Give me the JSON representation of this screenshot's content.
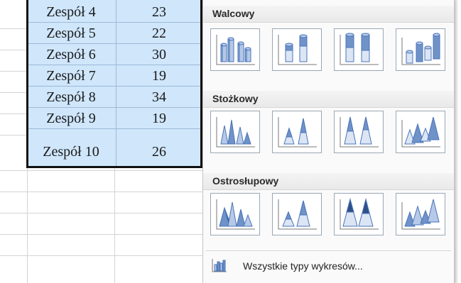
{
  "sheet": {
    "rows": [
      {
        "name": "Zespół 4",
        "value": "23"
      },
      {
        "name": "Zespół 5",
        "value": "22"
      },
      {
        "name": "Zespół 6",
        "value": "30"
      },
      {
        "name": "Zespół 7",
        "value": "19"
      },
      {
        "name": "Zespół 8",
        "value": "34"
      },
      {
        "name": "Zespół 9",
        "value": "19"
      },
      {
        "name": "Zespół 10",
        "value": "26"
      }
    ],
    "selection_color": "#cfe6fb"
  },
  "gallery": {
    "sections": [
      {
        "title": "Walcowy",
        "thumbs": [
          "clustered-cylinder-icon",
          "stacked-cylinder-icon",
          "100-stacked-cylinder-icon",
          "3d-cylinder-icon"
        ]
      },
      {
        "title": "Stożkowy",
        "thumbs": [
          "clustered-cone-icon",
          "stacked-cone-icon",
          "100-stacked-cone-icon",
          "3d-cone-icon"
        ]
      },
      {
        "title": "Ostrosłupowy",
        "thumbs": [
          "clustered-pyramid-icon",
          "stacked-pyramid-icon",
          "100-stacked-pyramid-icon",
          "3d-pyramid-icon"
        ]
      }
    ],
    "all_types_label": "Wszystkie typy wykresów...",
    "accent_color": "#4a74b8"
  }
}
